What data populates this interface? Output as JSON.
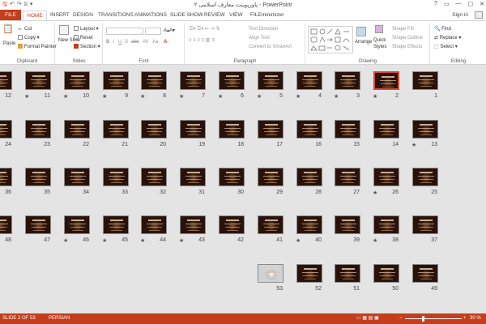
{
  "titlebar": {
    "title": "پاورپوینت معارف اسلامی ۲ - PowerPoint",
    "qat": [
      "🖫",
      "↶",
      "↷",
      "⌸",
      "▾"
    ],
    "window_buttons": [
      "?",
      "▭",
      "—",
      "▢",
      "✕"
    ]
  },
  "tabs": [
    "FILE",
    "HOME",
    "INSERT",
    "DESIGN",
    "TRANSITIONS",
    "ANIMATIONS",
    "SLIDE SHOW",
    "REVIEW",
    "VIEW",
    "FILEminimizer"
  ],
  "active_tab": "HOME",
  "sign_in": "Sign in",
  "ribbon": {
    "clipboard": {
      "label": "Clipboard",
      "paste": "Paste",
      "cut": "Cut",
      "copy": "Copy",
      "format_painter": "Format Painter"
    },
    "slides": {
      "label": "Slides",
      "new_slide": "New Slide",
      "layout": "Layout",
      "reset": "Reset",
      "section": "Section"
    },
    "font": {
      "label": "Font",
      "bold": "B",
      "italic": "I",
      "underline": "U",
      "shadow": "S",
      "strike": "abc",
      "spacing": "AV",
      "case": "Aa",
      "color": "A"
    },
    "paragraph": {
      "label": "Paragraph",
      "text_direction": "Text Direction",
      "align_text": "Align Text",
      "convert_smartart": "Convert to SmartArt"
    },
    "drawing": {
      "label": "Drawing",
      "arrange": "Arrange",
      "quick_styles": "Quick Styles",
      "shape_fill": "Shape Fill",
      "shape_outline": "Shape Outline",
      "shape_effects": "Shape Effects"
    },
    "editing": {
      "label": "Editing",
      "find": "Find",
      "replace": "Replace",
      "select": "Select"
    }
  },
  "slides": [
    {
      "n": "1",
      "star": false
    },
    {
      "n": "2",
      "star": true
    },
    {
      "n": "3",
      "star": true
    },
    {
      "n": "4",
      "star": true
    },
    {
      "n": "5",
      "star": true
    },
    {
      "n": "6",
      "star": true
    },
    {
      "n": "7",
      "star": true
    },
    {
      "n": "8",
      "star": true
    },
    {
      "n": "9",
      "star": true
    },
    {
      "n": "10",
      "star": true
    },
    {
      "n": "11",
      "star": true
    },
    {
      "n": "12",
      "star": true
    },
    {
      "n": "13",
      "star": true
    },
    {
      "n": "14",
      "star": false
    },
    {
      "n": "15",
      "star": false
    },
    {
      "n": "16",
      "star": false
    },
    {
      "n": "17",
      "star": false
    },
    {
      "n": "18",
      "star": false
    },
    {
      "n": "19",
      "star": false
    },
    {
      "n": "20",
      "star": false
    },
    {
      "n": "21",
      "star": false
    },
    {
      "n": "22",
      "star": false
    },
    {
      "n": "23",
      "star": false
    },
    {
      "n": "24",
      "star": false
    },
    {
      "n": "25",
      "star": false
    },
    {
      "n": "26",
      "star": true
    },
    {
      "n": "27",
      "star": false
    },
    {
      "n": "28",
      "star": false
    },
    {
      "n": "29",
      "star": false
    },
    {
      "n": "30",
      "star": false
    },
    {
      "n": "31",
      "star": false
    },
    {
      "n": "32",
      "star": false
    },
    {
      "n": "33",
      "star": false
    },
    {
      "n": "34",
      "star": false
    },
    {
      "n": "35",
      "star": false
    },
    {
      "n": "36",
      "star": false
    },
    {
      "n": "37",
      "star": false
    },
    {
      "n": "38",
      "star": true
    },
    {
      "n": "39",
      "star": false
    },
    {
      "n": "40",
      "star": true
    },
    {
      "n": "41",
      "star": false
    },
    {
      "n": "42",
      "star": false
    },
    {
      "n": "43",
      "star": true
    },
    {
      "n": "44",
      "star": true
    },
    {
      "n": "45",
      "star": true
    },
    {
      "n": "46",
      "star": true
    },
    {
      "n": "47",
      "star": false
    },
    {
      "n": "48",
      "star": false
    },
    {
      "n": "49",
      "star": false
    },
    {
      "n": "50",
      "star": false
    },
    {
      "n": "51",
      "star": false
    },
    {
      "n": "52",
      "star": false
    },
    {
      "n": "53",
      "star": false
    }
  ],
  "selected_slide": "2",
  "photo_slide": "53",
  "status": {
    "slide_of": "SLIDE 2 OF 53",
    "language": "PERSIAN",
    "zoom": "30 %",
    "zoom_level": 0.3
  },
  "colors": {
    "accent": "#c43e1c",
    "selection": "#d34a2c",
    "slide_bg": "#2a1208"
  }
}
